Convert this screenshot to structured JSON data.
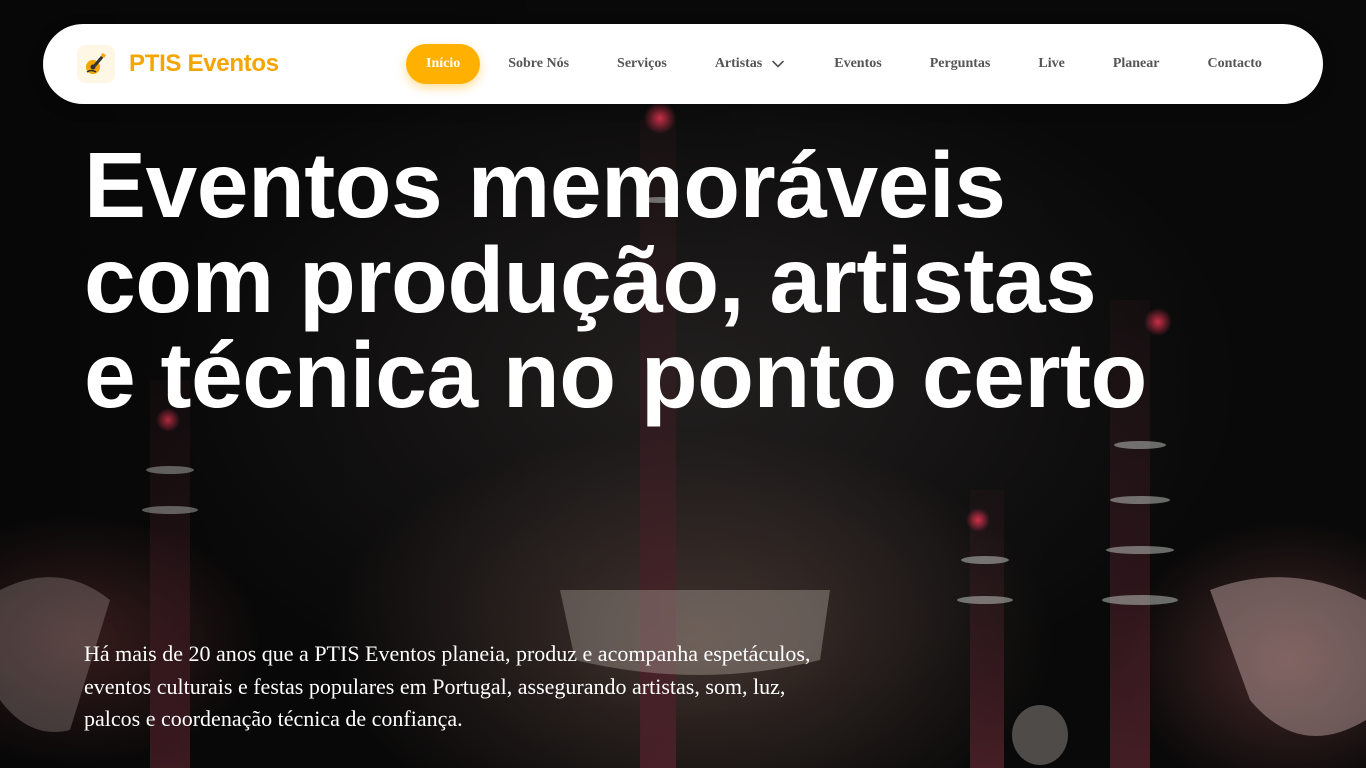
{
  "brand": {
    "name": "PTIS Eventos",
    "logo_icon": "guitar-logo-icon",
    "color": "#f5a500"
  },
  "nav": {
    "items": [
      {
        "label": "Início",
        "active": true
      },
      {
        "label": "Sobre Nós",
        "active": false
      },
      {
        "label": "Serviços",
        "active": false
      },
      {
        "label": "Artistas",
        "active": false,
        "has_dropdown": true
      },
      {
        "label": "Eventos",
        "active": false
      },
      {
        "label": "Perguntas",
        "active": false
      },
      {
        "label": "Live",
        "active": false
      },
      {
        "label": "Planear",
        "active": false
      },
      {
        "label": "Contacto",
        "active": false
      }
    ],
    "active_color": "#ffb000",
    "dropdown_icon": "chevron-down-icon"
  },
  "hero": {
    "title": "Eventos memoráveis com produção, artistas e técnica no ponto certo",
    "description": "Há mais de 20 anos que a PTIS Eventos planeia, produz e acompanha espetáculos, eventos culturais e festas populares em Portugal, assegurando artistas, som, luz, palcos e coordenação técnica de confiança."
  }
}
